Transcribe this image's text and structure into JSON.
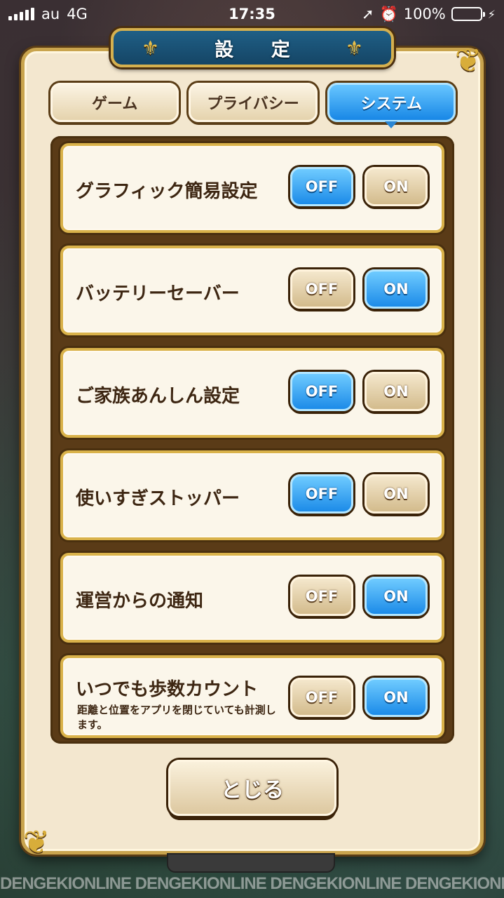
{
  "status_bar": {
    "carrier": "au",
    "network": "4G",
    "time": "17:35",
    "battery": "100%",
    "battery_color": "#4cd964"
  },
  "title": "設 定",
  "tabs": [
    {
      "label": "ゲーム",
      "active": false
    },
    {
      "label": "プライバシー",
      "active": false
    },
    {
      "label": "システム",
      "active": true
    }
  ],
  "settings": [
    {
      "label": "グラフィック簡易設定",
      "sub": "",
      "off_label": "OFF",
      "on_label": "ON",
      "selected": "OFF"
    },
    {
      "label": "バッテリーセーバー",
      "sub": "",
      "off_label": "OFF",
      "on_label": "ON",
      "selected": "ON"
    },
    {
      "label": "ご家族あんしん設定",
      "sub": "",
      "off_label": "OFF",
      "on_label": "ON",
      "selected": "OFF"
    },
    {
      "label": "使いすぎストッパー",
      "sub": "",
      "off_label": "OFF",
      "on_label": "ON",
      "selected": "OFF"
    },
    {
      "label": "運営からの通知",
      "sub": "",
      "off_label": "OFF",
      "on_label": "ON",
      "selected": "ON"
    },
    {
      "label": "いつでも歩数カウント",
      "sub": "距離と位置をアプリを閉じていても計測します。",
      "off_label": "OFF",
      "on_label": "ON",
      "selected": "ON"
    }
  ],
  "close_label": "とじる",
  "watermark": "DENGEKIONLINE DENGEKIONLINE DENGEKIONLINE DENGEKIONLINE",
  "colors": {
    "accent_blue": "#1c8be8",
    "panel": "#f3e7cf",
    "gold_border": "#d9b24a",
    "dark_brown": "#5a3b17"
  }
}
